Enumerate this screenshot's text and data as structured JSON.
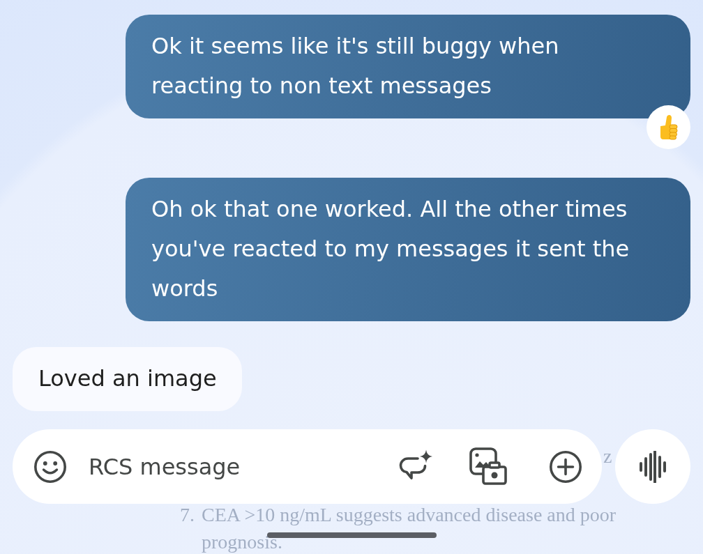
{
  "messages": [
    {
      "kind": "sent",
      "text": "Ok it seems like it's still buggy when reacting to non text messages",
      "reaction": {
        "kind": "thumbs_up"
      }
    },
    {
      "kind": "sent",
      "text": "Oh ok that one worked. All the other times you've reacted to my messages it sent the words"
    },
    {
      "kind": "received",
      "text": "Loved an image"
    }
  ],
  "compose": {
    "placeholder": "RCS message"
  },
  "background_text": {
    "fragment": "z",
    "item": {
      "number": "7.",
      "lines": [
        "CEA >10 ng/mL suggests advanced disease and poor",
        "prognosis."
      ]
    }
  }
}
